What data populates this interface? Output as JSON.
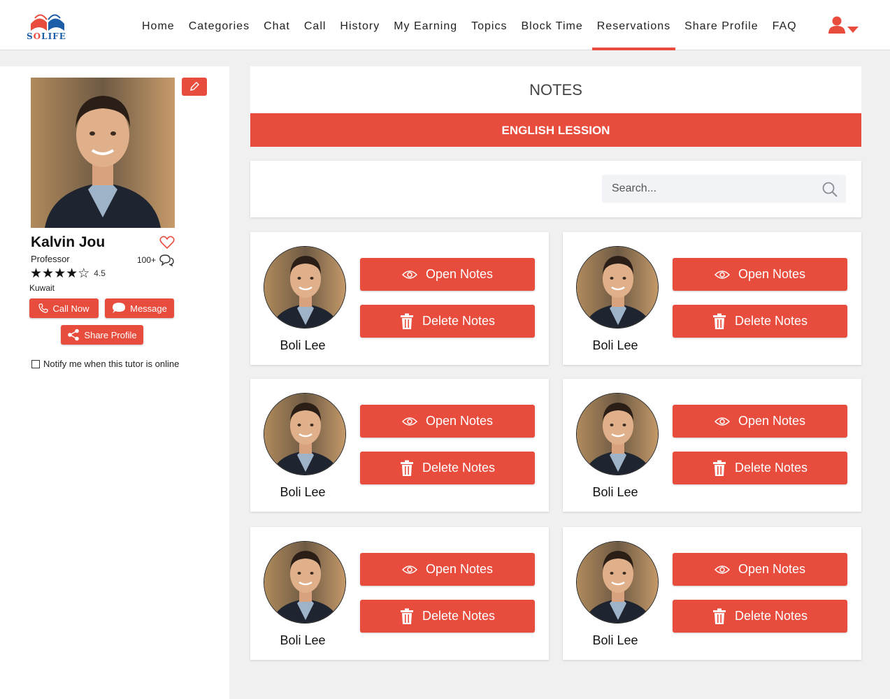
{
  "brand": {
    "name_prefix": "S",
    "name_o": "O",
    "name_suffix": "LIFE"
  },
  "nav": [
    {
      "label": "Home",
      "name": "nav-home",
      "active": false
    },
    {
      "label": "Categories",
      "name": "nav-categories",
      "active": false
    },
    {
      "label": "Chat",
      "name": "nav-chat",
      "active": false
    },
    {
      "label": "Call",
      "name": "nav-call",
      "active": false
    },
    {
      "label": "History",
      "name": "nav-history",
      "active": false
    },
    {
      "label": "My Earning",
      "name": "nav-my-earning",
      "active": false
    },
    {
      "label": "Topics",
      "name": "nav-topics",
      "active": false
    },
    {
      "label": "Block Time",
      "name": "nav-block-time",
      "active": false
    },
    {
      "label": "Reservations",
      "name": "nav-reservations",
      "active": true
    },
    {
      "label": "Share Profile",
      "name": "nav-share-profile",
      "active": false
    },
    {
      "label": "FAQ",
      "name": "nav-faq",
      "active": false
    }
  ],
  "profile": {
    "name": "Kalvin Jou",
    "role": "Professor",
    "rating": 4.5,
    "rating_text": "4.5",
    "reviews_count": "100+",
    "country": "Kuwait",
    "call_label": "Call Now",
    "message_label": "Message",
    "share_label": "Share Profile",
    "notify_label": "Notify me when this tutor is online",
    "notify_checked": false
  },
  "notes": {
    "title": "NOTES",
    "lesson": "ENGLISH LESSION",
    "search_placeholder": "Search...",
    "open_label": "Open Notes",
    "delete_label": "Delete Notes",
    "cards": [
      {
        "name": "Boli Lee"
      },
      {
        "name": "Boli Lee"
      },
      {
        "name": "Boli Lee"
      },
      {
        "name": "Boli Lee"
      },
      {
        "name": "Boli Lee"
      },
      {
        "name": "Boli Lee"
      }
    ]
  },
  "colors": {
    "accent": "#e84c3d",
    "brand_blue": "#1c5fa8",
    "page_bg": "#f1f0f0"
  },
  "icons": [
    "user-icon",
    "pencil-icon",
    "heart-icon",
    "chat-bubbles-icon",
    "phone-icon",
    "message-icon",
    "share-icon",
    "search-icon",
    "eye-icon",
    "trash-icon"
  ]
}
